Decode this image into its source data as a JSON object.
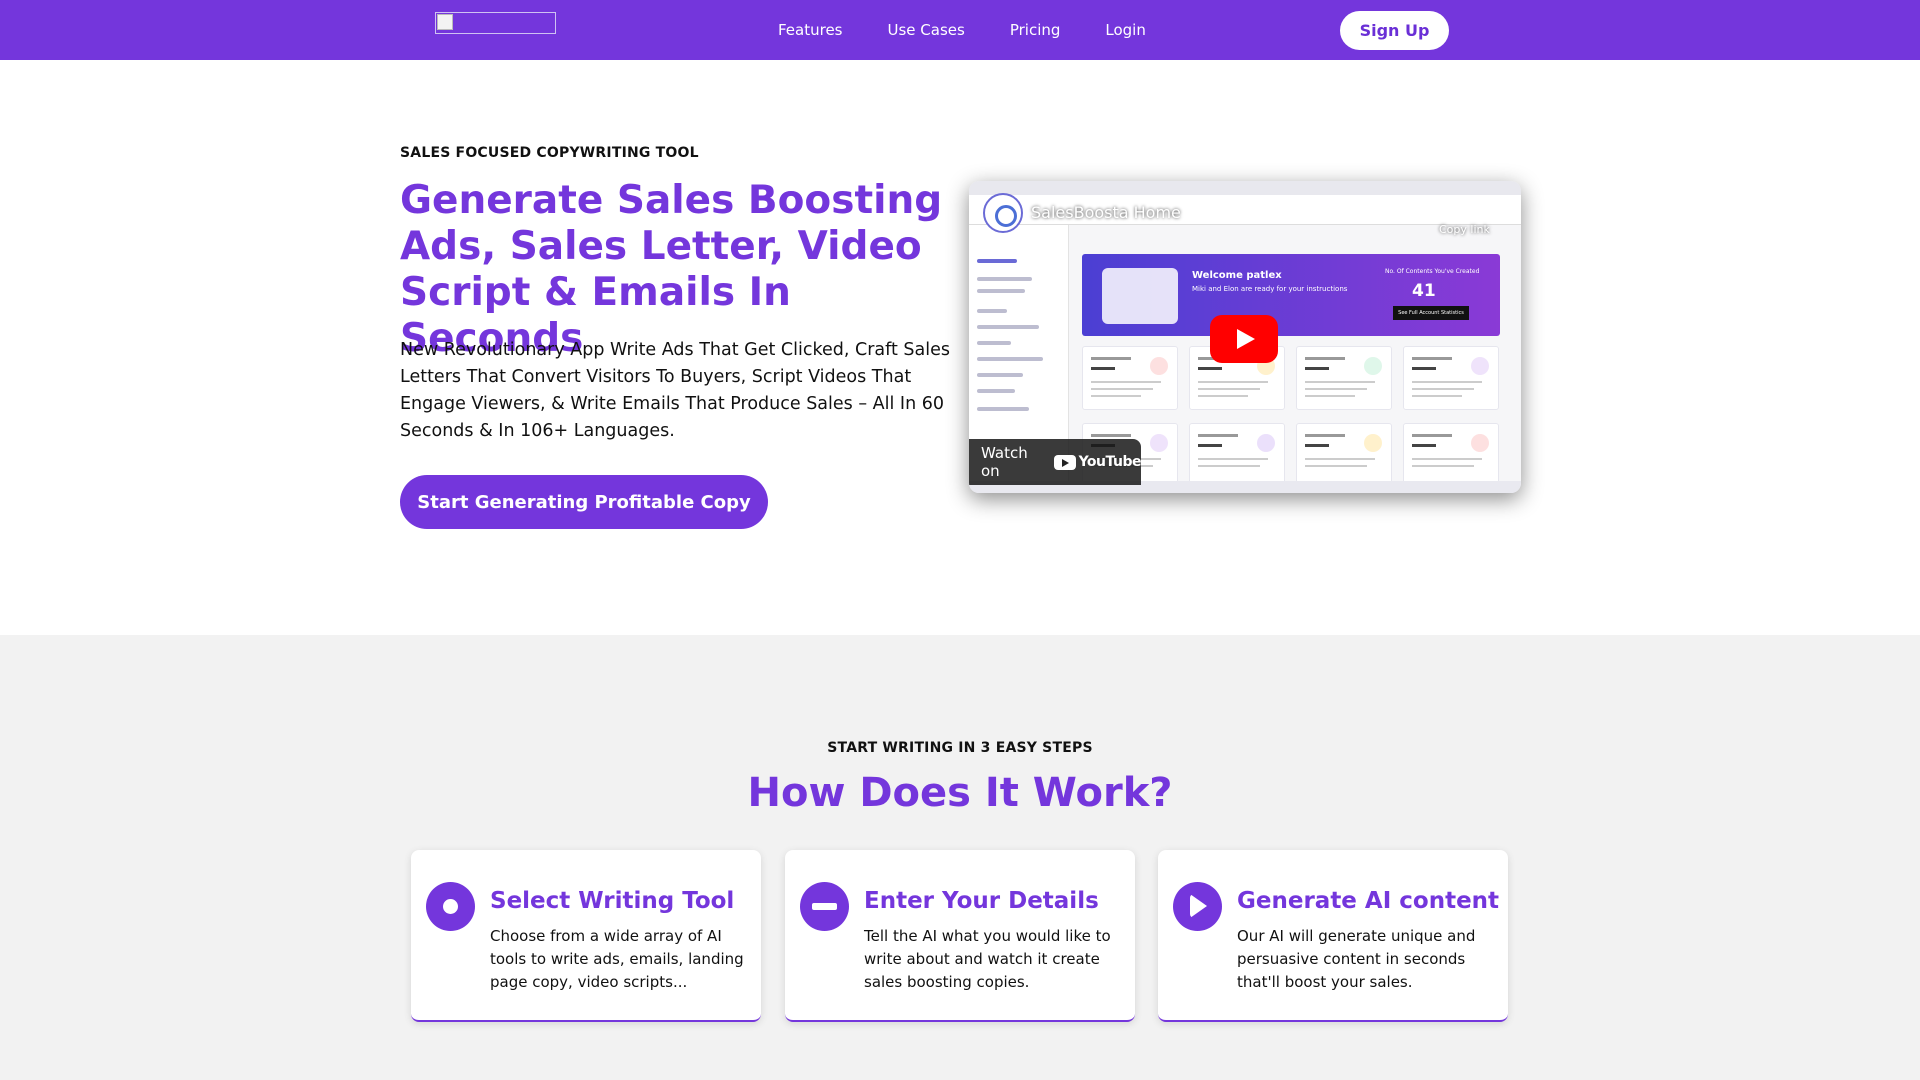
{
  "nav": {
    "links": [
      "Features",
      "Use Cases",
      "Pricing",
      "Login"
    ],
    "signup_label": "Sign Up"
  },
  "hero": {
    "eyebrow": "SALES FOCUSED COPYWRITING TOOL",
    "title": "Generate Sales Boosting Ads, Sales Letter, Video Script & Emails In Seconds",
    "description": "New Revolutionary App Write Ads That Get Clicked, Craft Sales Letters That Convert Visitors To Buyers, Script Videos That Engage Viewers, & Write Emails That Produce Sales – All In 60 Seconds & In 106+ Languages.",
    "cta_label": "Start Generating Profitable Copy"
  },
  "video": {
    "title": "SalesBoosta Home",
    "copy_link_label": "Copy link",
    "watch_on_label": "Watch on",
    "youtube_word": "YouTube",
    "screen": {
      "welcome": "Welcome patlex",
      "subtitle": "Miki and Elon are ready for your instructions",
      "contents_label": "No. Of Contents You've Created",
      "contents_count": "41",
      "stats_button": "See Full Account Statistics"
    }
  },
  "how": {
    "eyebrow": "START WRITING IN 3 EASY STEPS",
    "title": "How Does It Work?",
    "steps": [
      {
        "title": "Select Writing Tool",
        "desc": "Choose from a wide array of AI tools to write ads, emails, landing page copy, video scripts...",
        "icon": "circle-dot-icon"
      },
      {
        "title": "Enter Your Details",
        "desc": "Tell the AI what you would like to write about and watch it create sales boosting copies.",
        "icon": "minus-circle-icon"
      },
      {
        "title": "Generate AI content",
        "desc": "Our AI will generate unique and persuasive content in seconds that'll boost your sales.",
        "icon": "play-circle-icon"
      }
    ]
  },
  "colors": {
    "brand": "#7436dc",
    "section_bg": "#f2f2f2",
    "youtube_red": "#ff0000"
  }
}
